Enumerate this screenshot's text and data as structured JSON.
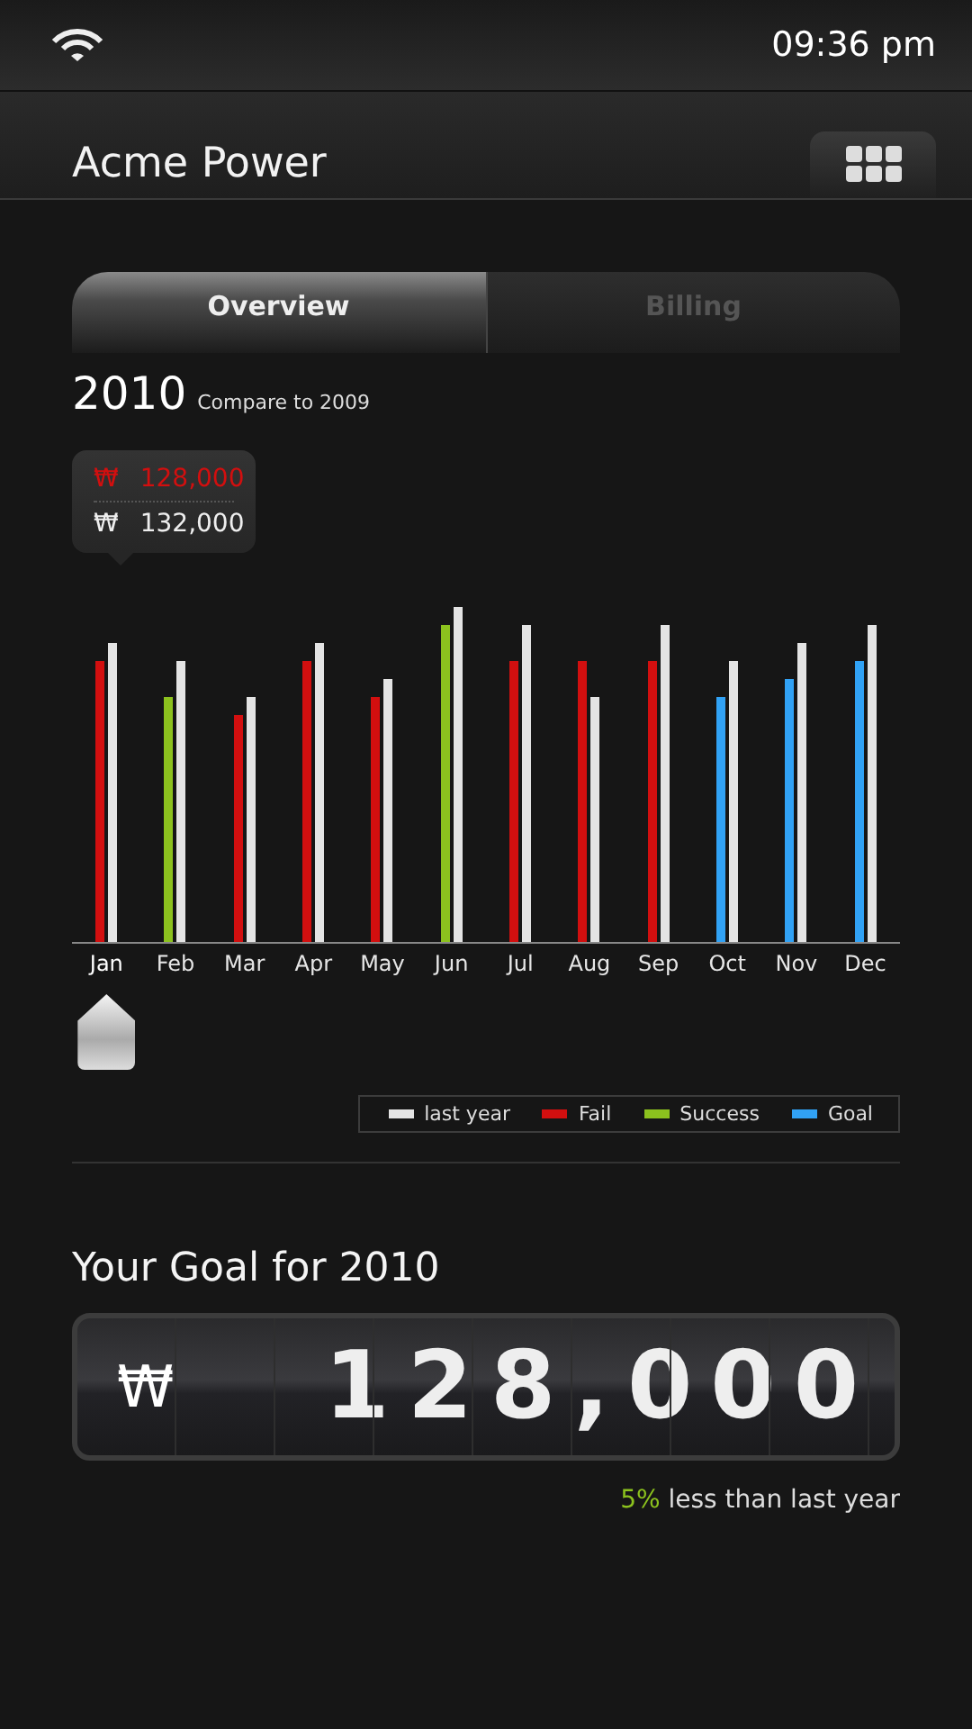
{
  "status_bar": {
    "time": "09:36 pm"
  },
  "header": {
    "title": "Acme Power"
  },
  "tabs": [
    {
      "label": "Overview",
      "selected": true
    },
    {
      "label": "Billing",
      "selected": false
    }
  ],
  "chart_heading": {
    "year": "2010",
    "subtitle": "Compare to 2009"
  },
  "tooltip": [
    {
      "kind": "fail",
      "currency": "₩",
      "amount": "128,000"
    },
    {
      "kind": "last_year",
      "currency": "₩",
      "amount": "132,000"
    }
  ],
  "months": [
    {
      "label": "Jan",
      "selected": true,
      "bars": [
        {
          "kind": "fail"
        },
        {
          "kind": "last_year"
        }
      ]
    },
    {
      "label": "Feb",
      "selected": false,
      "bars": [
        {
          "kind": "success"
        },
        {
          "kind": "last_year"
        }
      ]
    },
    {
      "label": "Mar",
      "selected": false,
      "bars": [
        {
          "kind": "fail"
        },
        {
          "kind": "last_year"
        }
      ]
    },
    {
      "label": "Apr",
      "selected": false,
      "bars": [
        {
          "kind": "fail"
        },
        {
          "kind": "last_year"
        }
      ]
    },
    {
      "label": "May",
      "selected": false,
      "bars": [
        {
          "kind": "fail"
        },
        {
          "kind": "last_year"
        }
      ]
    },
    {
      "label": "Jun",
      "selected": false,
      "bars": [
        {
          "kind": "success"
        },
        {
          "kind": "last_year"
        }
      ]
    },
    {
      "label": "Jul",
      "selected": false,
      "bars": [
        {
          "kind": "fail"
        },
        {
          "kind": "last_year"
        }
      ]
    },
    {
      "label": "Aug",
      "selected": false,
      "bars": [
        {
          "kind": "fail"
        },
        {
          "kind": "last_year"
        }
      ]
    },
    {
      "label": "Sep",
      "selected": false,
      "bars": [
        {
          "kind": "fail"
        },
        {
          "kind": "last_year"
        }
      ]
    },
    {
      "label": "Oct",
      "selected": false,
      "bars": [
        {
          "kind": "goal"
        },
        {
          "kind": "last_year"
        }
      ]
    },
    {
      "label": "Nov",
      "selected": false,
      "bars": [
        {
          "kind": "goal"
        },
        {
          "kind": "last_year"
        }
      ]
    },
    {
      "label": "Dec",
      "selected": false,
      "bars": [
        {
          "kind": "goal"
        },
        {
          "kind": "last_year"
        }
      ]
    }
  ],
  "legend": [
    {
      "kind": "last_year",
      "label": "last year"
    },
    {
      "kind": "fail",
      "label": "Fail"
    },
    {
      "kind": "success",
      "label": "Success"
    },
    {
      "kind": "goal",
      "label": "Goal"
    }
  ],
  "goal": {
    "title": "Your Goal for 2010",
    "currency": "₩",
    "amount": "128,000"
  },
  "note": {
    "highlight": "5%",
    "text": "less than last year"
  }
}
